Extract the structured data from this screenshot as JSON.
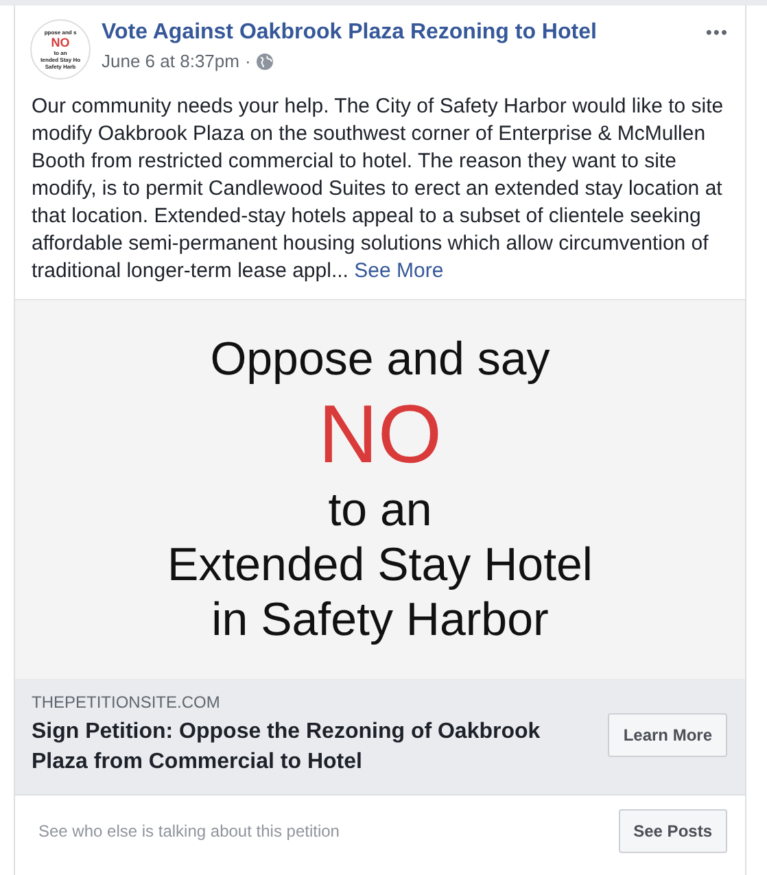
{
  "post": {
    "avatar_lines": [
      {
        "text": "ppose and s",
        "kind": "plain"
      },
      {
        "text": "NO",
        "kind": "accent"
      },
      {
        "text": "to an",
        "kind": "plain"
      },
      {
        "text": "tended Stay Ho",
        "kind": "plain"
      },
      {
        "text": "Safety Harb",
        "kind": "plain"
      }
    ],
    "author": "Vote Against Oakbrook Plaza Rezoning to Hotel",
    "time": "June 6 at 8:37pm",
    "separator": "·",
    "more_menu": "•••",
    "body": "Our community needs your help. The City of Safety Harbor would like to site modify Oakbrook Plaza on the southwest corner of Enterprise & McMullen Booth from restricted commercial to hotel. The reason they want to site modify, is to permit Candlewood Suites to erect an extended stay location at that location. Extended-stay hotels appeal to a subset of clientele seeking affordable semi-permanent housing solutions which allow circumvention of traditional longer-term lease appl...",
    "see_more": "See More"
  },
  "link_image": {
    "lines": [
      {
        "text": "Oppose and say",
        "kind": "plain"
      },
      {
        "text": "NO",
        "kind": "accent"
      },
      {
        "text": "to an",
        "kind": "plain"
      },
      {
        "text": "Extended Stay Hotel",
        "kind": "plain"
      },
      {
        "text": "in Safety Harbor",
        "kind": "plain"
      }
    ]
  },
  "link_preview": {
    "domain": "THEPETITIONSITE.COM",
    "title": "Sign Petition: Oppose the Rezoning of Oakbrook Plaza from Commercial to Hotel",
    "button": "Learn More"
  },
  "footer": {
    "text": "See who else is talking about this petition",
    "button": "See Posts"
  }
}
